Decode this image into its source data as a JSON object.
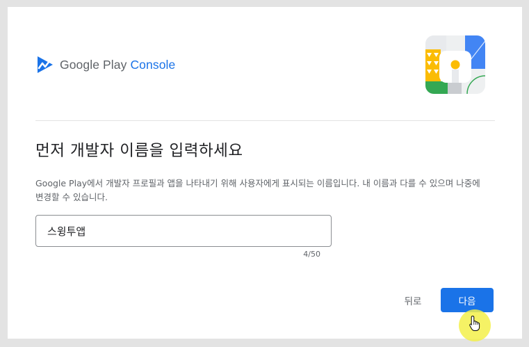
{
  "brand": {
    "name_part1": "Google Play",
    "name_part2": "Console"
  },
  "page": {
    "title": "먼저 개발자 이름을 입력하세요",
    "description": "Google Play에서 개발자 프로필과 앱을 나타내기 위해 사용자에게 표시되는 이름입니다. 내 이름과 다를 수 있으며 나중에 변경할 수 있습니다."
  },
  "form": {
    "developer_name_value": "스윙투앱",
    "char_counter": "4/50"
  },
  "actions": {
    "back_label": "뒤로",
    "next_label": "다음"
  },
  "colors": {
    "accent": "#1a73e8",
    "cursor_highlight": "#f3f04a"
  },
  "icons": {
    "brand": "play-console-logo-icon",
    "illustration": "play-console-illustration",
    "cursor": "hand-pointer-icon"
  }
}
